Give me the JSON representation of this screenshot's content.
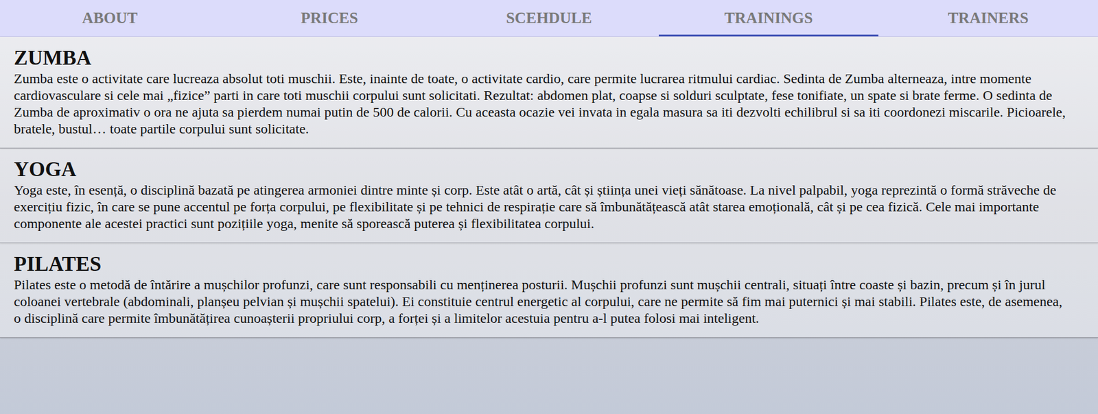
{
  "tabs": [
    {
      "label": "ABOUT",
      "selected": false
    },
    {
      "label": "PRICES",
      "selected": false
    },
    {
      "label": "SCEHDULE",
      "selected": false
    },
    {
      "label": "TRAININGS",
      "selected": true
    },
    {
      "label": "TRAINERS",
      "selected": false
    }
  ],
  "trainings": [
    {
      "title": "ZUMBA",
      "text": "Zumba este o activitate care lucreaza absolut toti muschii. Este, inainte de toate, o activitate cardio, care permite lucrarea ritmului cardiac. Sedinta de Zumba alterneaza, intre momente cardiovasculare si cele mai „fizice” parti in care toti muschii corpului sunt solicitati. Rezultat: abdomen plat, coapse si solduri sculptate, fese tonifiate, un spate si brate ferme. O sedinta de Zumba de aproximativ o ora ne ajuta sa pierdem numai putin de 500 de calorii. Cu aceasta ocazie vei invata in egala masura sa iti dezvolti echilibrul si sa iti coordonezi miscarile. Picioarele, bratele, bustul… toate partile corpului sunt solicitate."
    },
    {
      "title": "YOGA",
      "text": "Yoga este, în esență, o disciplină bazată pe atingerea armoniei dintre minte și corp. Este atât o artă, cât și știința unei vieți sănătoase. La nivel palpabil, yoga reprezintă o formă străveche de exercițiu fizic, în care se pune accentul pe forța corpului, pe flexibilitate și pe tehnici de respirație care să îmbunătățească atât starea emoțională, cât și pe cea fizică. Cele mai importante componente ale acestei practici sunt pozițiile yoga, menite să sporească puterea și flexibilitatea corpului."
    },
    {
      "title": "PILATES",
      "text": "Pilates este o metodă de întărire a mușchilor profunzi, care sunt responsabili cu menținerea posturii. Mușchii profunzi sunt mușchii centrali, situați între coaste și bazin, precum și în jurul coloanei vertebrale (abdominali, planșeu pelvian și mușchii spatelui). Ei constituie centrul energetic al corpului, care ne permite să fim mai puternici și mai stabili. Pilates este, de asemenea, o disciplină care permite îmbunătățirea cunoașterii propriului corp, a forței și a limitelor acestuia pentru a-l putea folosi mai inteligent."
    }
  ]
}
